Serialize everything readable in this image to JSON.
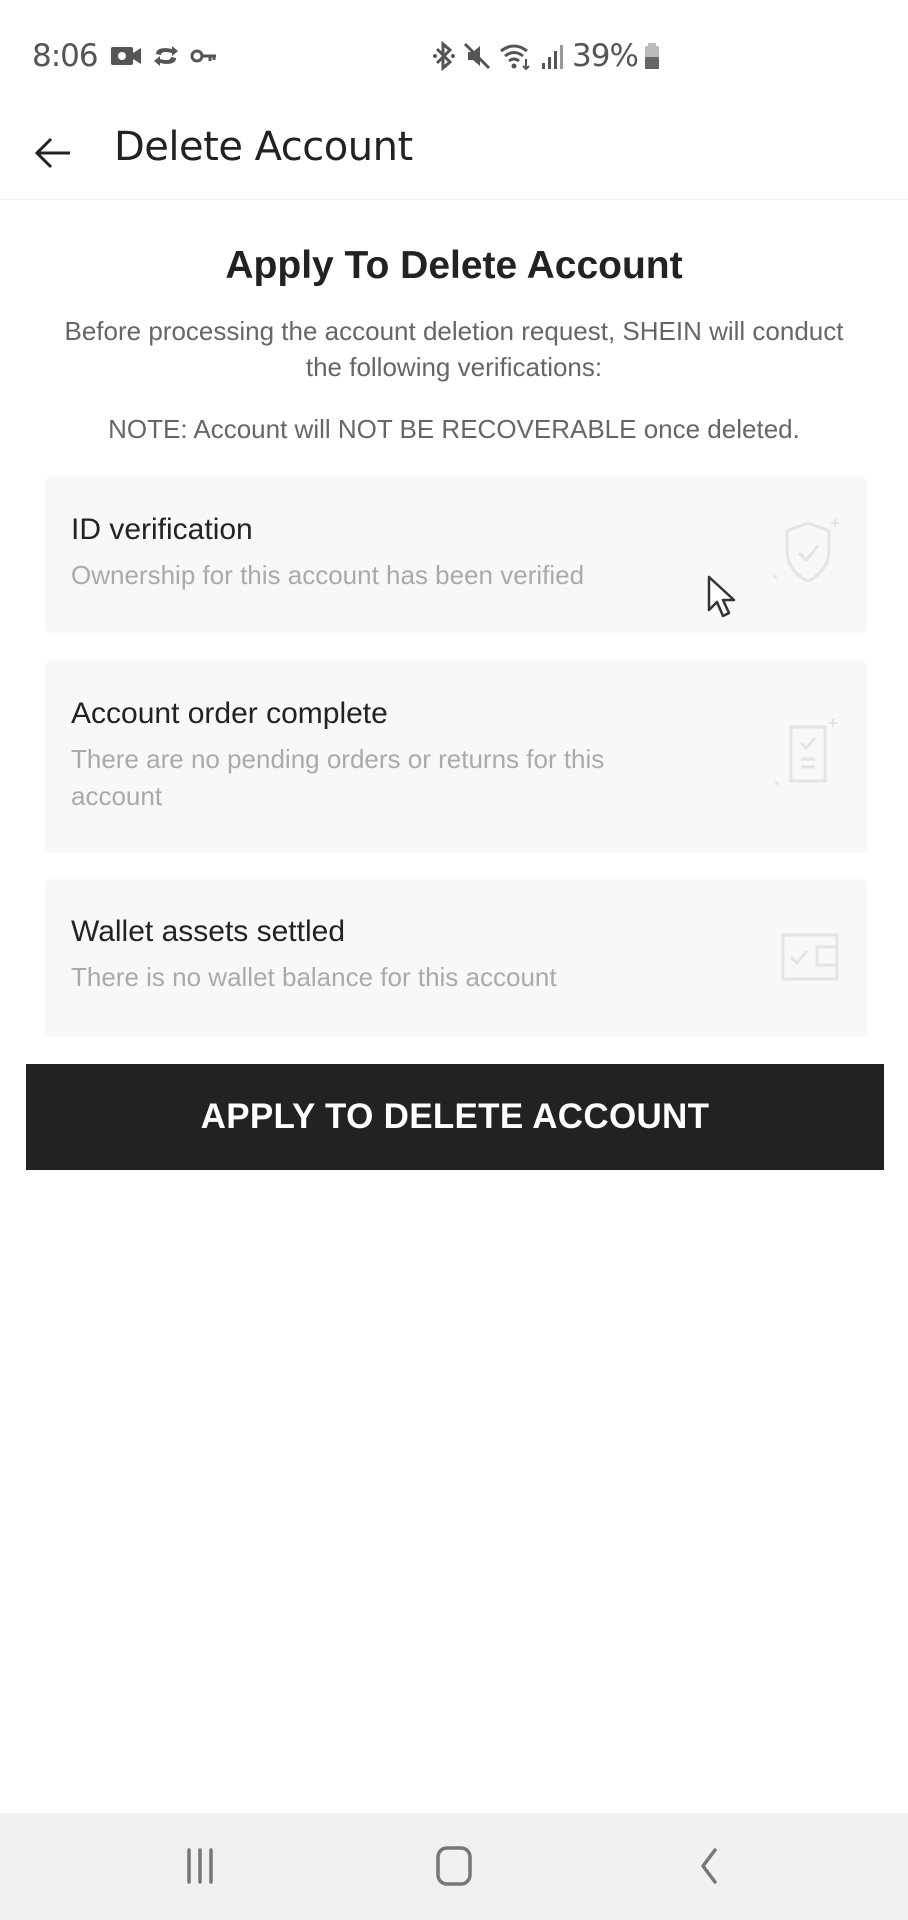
{
  "status_bar": {
    "time": "8:06",
    "left_icons": [
      "video-camera-icon",
      "sync-icon",
      "key-icon"
    ],
    "right_icons": [
      "bluetooth-icon",
      "mute-icon",
      "wifi-icon",
      "signal-icon"
    ],
    "battery_percent": "39%"
  },
  "header": {
    "back_icon": "arrow-left-icon",
    "title": "Delete Account"
  },
  "main": {
    "title": "Apply To Delete Account",
    "intro": "Before processing the account deletion request, SHEIN will conduct the following verifications:",
    "note": "NOTE: Account will NOT BE RECOVERABLE once deleted.",
    "verifications": [
      {
        "title": "ID verification",
        "description": "Ownership for this account has been verified",
        "icon": "shield-check-icon"
      },
      {
        "title": "Account order complete",
        "description": "There are no pending orders or returns for this account",
        "icon": "order-checklist-icon"
      },
      {
        "title": "Wallet assets settled",
        "description": "There is no wallet balance for this account",
        "icon": "wallet-check-icon"
      }
    ],
    "apply_button": "APPLY TO DELETE ACCOUNT"
  },
  "nav_bar": {
    "recent_apps": "recent-apps-icon",
    "home": "home-icon",
    "back": "back-icon"
  }
}
